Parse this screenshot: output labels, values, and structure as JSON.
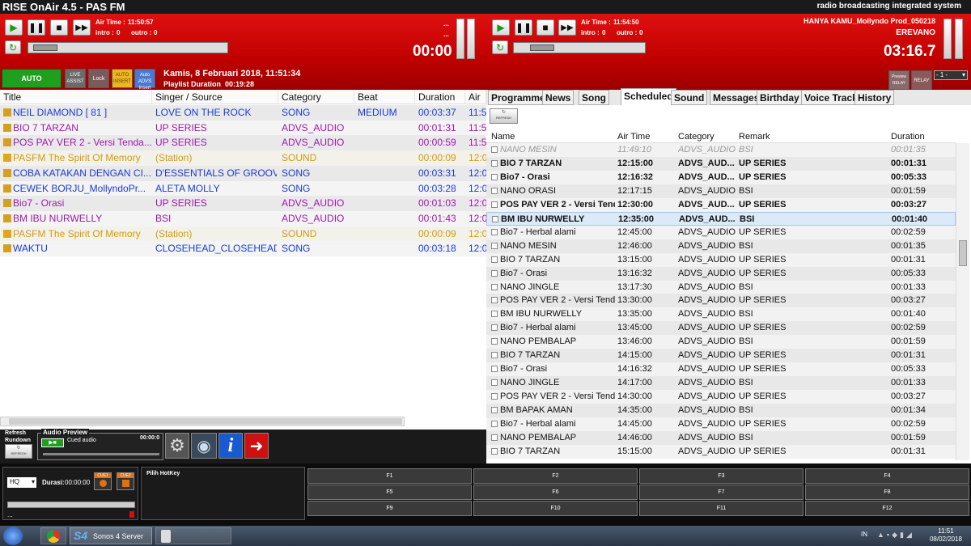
{
  "window": {
    "title": "RISE OnAir 4.5 - PAS FM",
    "tagline": "radio broadcasting integrated system"
  },
  "player_left": {
    "air_time_label": "Air Time :",
    "air_time": "11:50:57",
    "intro_label": "intro :",
    "intro": "0",
    "outro_label": "outro :",
    "outro": "0",
    "dots1": "...",
    "dots2": "...",
    "remaining": "00:00"
  },
  "player_right": {
    "air_time_label": "Air Time :",
    "air_time": "11:54:50",
    "intro_label": "intro :",
    "intro": "0",
    "outro_label": "outro :",
    "outro": "0",
    "song": "HANYA KAMU_Mollyndo Prod_050218",
    "artist": "EREVANO",
    "remaining": "03:16.7"
  },
  "mode_bar": {
    "auto_label": "AUTO",
    "live_assist_label": "LIVE ASSIST",
    "lock_label": "Lock",
    "auto_insert_label": "AUTO INSERT",
    "auto_advs_label": "Auto ADVS Insert",
    "date": "Kamis, 8 Februari 2018, 11:51:34",
    "playlist_duration_label": "Playlist Duration",
    "playlist_duration": "00:19:28",
    "preview_relay_label": "Preview RELAY",
    "relay_label": "RELAY",
    "relay_select": "- 1 -"
  },
  "playlist": {
    "columns": [
      "Title",
      "Singer / Source",
      "Category",
      "Beat",
      "Duration",
      "Air Ti"
    ],
    "rows": [
      {
        "title": "NEIL DIAMOND [ 81 ]",
        "singer": "LOVE ON THE ROCK",
        "category": "SONG",
        "beat": "MEDIUM",
        "duration": "00:03:37",
        "air": "11:5",
        "kind": "song"
      },
      {
        "title": "BIO 7 TARZAN",
        "singer": "UP SERIES",
        "category": "ADVS_AUDIO",
        "beat": "",
        "duration": "00:01:31",
        "air": "11:5",
        "kind": "advs"
      },
      {
        "title": "POS PAY VER 2 - Versi Tenda...",
        "singer": "UP SERIES",
        "category": "ADVS_AUDIO",
        "beat": "",
        "duration": "00:00:59",
        "air": "11:5",
        "kind": "advs"
      },
      {
        "title": "PASFM The Spirit Of Memory",
        "singer": "(Station)",
        "category": "SOUND",
        "beat": "",
        "duration": "00:00:09",
        "air": "12:0",
        "kind": "sound"
      },
      {
        "title": "COBA KATAKAN DENGAN CI...",
        "singer": "D'ESSENTIALS OF GROOV...",
        "category": "SONG",
        "beat": "",
        "duration": "00:03:31",
        "air": "12:0",
        "kind": "song"
      },
      {
        "title": "CEWEK  BORJU_MollyndoPr...",
        "singer": "ALETA MOLLY",
        "category": "SONG",
        "beat": "",
        "duration": "00:03:28",
        "air": "12:0",
        "kind": "song"
      },
      {
        "title": "Bio7 - Orasi",
        "singer": "UP SERIES",
        "category": "ADVS_AUDIO",
        "beat": "",
        "duration": "00:01:03",
        "air": "12:0",
        "kind": "advs"
      },
      {
        "title": "BM IBU NURWELLY",
        "singer": "BSI",
        "category": "ADVS_AUDIO",
        "beat": "",
        "duration": "00:01:43",
        "air": "12:0",
        "kind": "advs"
      },
      {
        "title": "PASFM The Spirit Of Memory",
        "singer": "(Station)",
        "category": "SOUND",
        "beat": "",
        "duration": "00:00:09",
        "air": "12:0",
        "kind": "sound"
      },
      {
        "title": "WAKTU",
        "singer": "CLOSEHEAD_CLOSEHEAD...",
        "category": "SONG",
        "beat": "",
        "duration": "00:03:18",
        "air": "12:0",
        "kind": "song"
      }
    ]
  },
  "tabs": [
    "Programme",
    "News",
    "Song",
    "Scheduled",
    "Sound",
    "Messages",
    "Birthday",
    "Voice Track",
    "History"
  ],
  "scheduled": {
    "refresh_label": "REFRESH",
    "columns": [
      "Name",
      "Air Time",
      "Category",
      "Remark",
      "Duration"
    ],
    "rows": [
      {
        "name": "NANO MESIN",
        "time": "11:49:10",
        "cat": "ADVS_AUDIO",
        "remark": "BSI",
        "dur": "00:01:35",
        "style": "dim"
      },
      {
        "name": "BIO 7 TARZAN",
        "time": "12:15:00",
        "cat": "ADVS_AUD...",
        "remark": "UP SERIES",
        "dur": "00:01:31",
        "style": "bold"
      },
      {
        "name": "Bio7 - Orasi",
        "time": "12:16:32",
        "cat": "ADVS_AUD...",
        "remark": "UP SERIES",
        "dur": "00:05:33",
        "style": "bold"
      },
      {
        "name": "NANO ORASI",
        "time": "12:17:15",
        "cat": "ADVS_AUDIO",
        "remark": "BSI",
        "dur": "00:01:59",
        "style": ""
      },
      {
        "name": "POS PAY VER 2 - Versi Tend...",
        "time": "12:30:00",
        "cat": "ADVS_AUD...",
        "remark": "UP SERIES",
        "dur": "00:03:27",
        "style": "bold"
      },
      {
        "name": "BM IBU NURWELLY",
        "time": "12:35:00",
        "cat": "ADVS_AUD...",
        "remark": "BSI",
        "dur": "00:01:40",
        "style": "bold hl"
      },
      {
        "name": "Bio7 - Herbal alami",
        "time": "12:45:00",
        "cat": "ADVS_AUDIO",
        "remark": "UP SERIES",
        "dur": "00:02:59",
        "style": ""
      },
      {
        "name": "NANO MESIN",
        "time": "12:46:00",
        "cat": "ADVS_AUDIO",
        "remark": "BSI",
        "dur": "00:01:35",
        "style": ""
      },
      {
        "name": "BIO 7 TARZAN",
        "time": "13:15:00",
        "cat": "ADVS_AUDIO",
        "remark": "UP SERIES",
        "dur": "00:01:31",
        "style": ""
      },
      {
        "name": "Bio7 - Orasi",
        "time": "13:16:32",
        "cat": "ADVS_AUDIO",
        "remark": "UP SERIES",
        "dur": "00:05:33",
        "style": ""
      },
      {
        "name": "NANO JINGLE",
        "time": "13:17:30",
        "cat": "ADVS_AUDIO",
        "remark": "BSI",
        "dur": "00:01:33",
        "style": ""
      },
      {
        "name": "POS PAY VER 2 - Versi Tend...",
        "time": "13:30:00",
        "cat": "ADVS_AUDIO",
        "remark": "UP SERIES",
        "dur": "00:03:27",
        "style": ""
      },
      {
        "name": "BM IBU NURWELLY",
        "time": "13:35:00",
        "cat": "ADVS_AUDIO",
        "remark": "BSI",
        "dur": "00:01:40",
        "style": ""
      },
      {
        "name": "Bio7 - Herbal alami",
        "time": "13:45:00",
        "cat": "ADVS_AUDIO",
        "remark": "UP SERIES",
        "dur": "00:02:59",
        "style": ""
      },
      {
        "name": "NANO PEMBALAP",
        "time": "13:46:00",
        "cat": "ADVS_AUDIO",
        "remark": "BSI",
        "dur": "00:01:59",
        "style": ""
      },
      {
        "name": "BIO 7 TARZAN",
        "time": "14:15:00",
        "cat": "ADVS_AUDIO",
        "remark": "UP SERIES",
        "dur": "00:01:31",
        "style": ""
      },
      {
        "name": "Bio7 - Orasi",
        "time": "14:16:32",
        "cat": "ADVS_AUDIO",
        "remark": "UP SERIES",
        "dur": "00:05:33",
        "style": ""
      },
      {
        "name": "NANO JINGLE",
        "time": "14:17:00",
        "cat": "ADVS_AUDIO",
        "remark": "BSI",
        "dur": "00:01:33",
        "style": ""
      },
      {
        "name": "POS PAY VER 2 - Versi Tend...",
        "time": "14:30:00",
        "cat": "ADVS_AUDIO",
        "remark": "UP SERIES",
        "dur": "00:03:27",
        "style": ""
      },
      {
        "name": "BM BAPAK AMAN",
        "time": "14:35:00",
        "cat": "ADVS_AUDIO",
        "remark": "BSI",
        "dur": "00:01:34",
        "style": ""
      },
      {
        "name": "Bio7 - Herbal alami",
        "time": "14:45:00",
        "cat": "ADVS_AUDIO",
        "remark": "UP SERIES",
        "dur": "00:02:59",
        "style": ""
      },
      {
        "name": "NANO PEMBALAP",
        "time": "14:46:00",
        "cat": "ADVS_AUDIO",
        "remark": "BSI",
        "dur": "00:01:59",
        "style": ""
      },
      {
        "name": "BIO 7 TARZAN",
        "time": "15:15:00",
        "cat": "ADVS_AUDIO",
        "remark": "UP SERIES",
        "dur": "00:01:31",
        "style": ""
      }
    ]
  },
  "bottom": {
    "refresh_rundown_label": "Refresh Rundown",
    "refresh_label": "REFRESH",
    "audio_preview_label": "Audio Preview",
    "cued_audio_label": "Cued audio",
    "cued_time": "00:00:0",
    "quality": "HQ",
    "durasi_label": "Durasi:",
    "durasi": "00:00:00",
    "cue1_label": "CUE1",
    "cue2_label": "CUE2",
    "dots": "...",
    "hotkey_label": "Pilih HotKey",
    "fkeys": [
      "F1",
      "F2",
      "F3",
      "F4",
      "F5",
      "F6",
      "F7",
      "F8",
      "F9",
      "F10",
      "F11",
      "F12"
    ]
  },
  "taskbar": {
    "task_label": "Sonos 4 Server",
    "task_logo": "S4",
    "lang": "IN",
    "time": "11:51",
    "date": "08/02/2018"
  },
  "colors": {
    "song": "#1a3bd6",
    "advs": "#9a1aa8",
    "sound": "#d49a10",
    "header_red": "#cc0000",
    "auto_green": "#1ea01e"
  }
}
